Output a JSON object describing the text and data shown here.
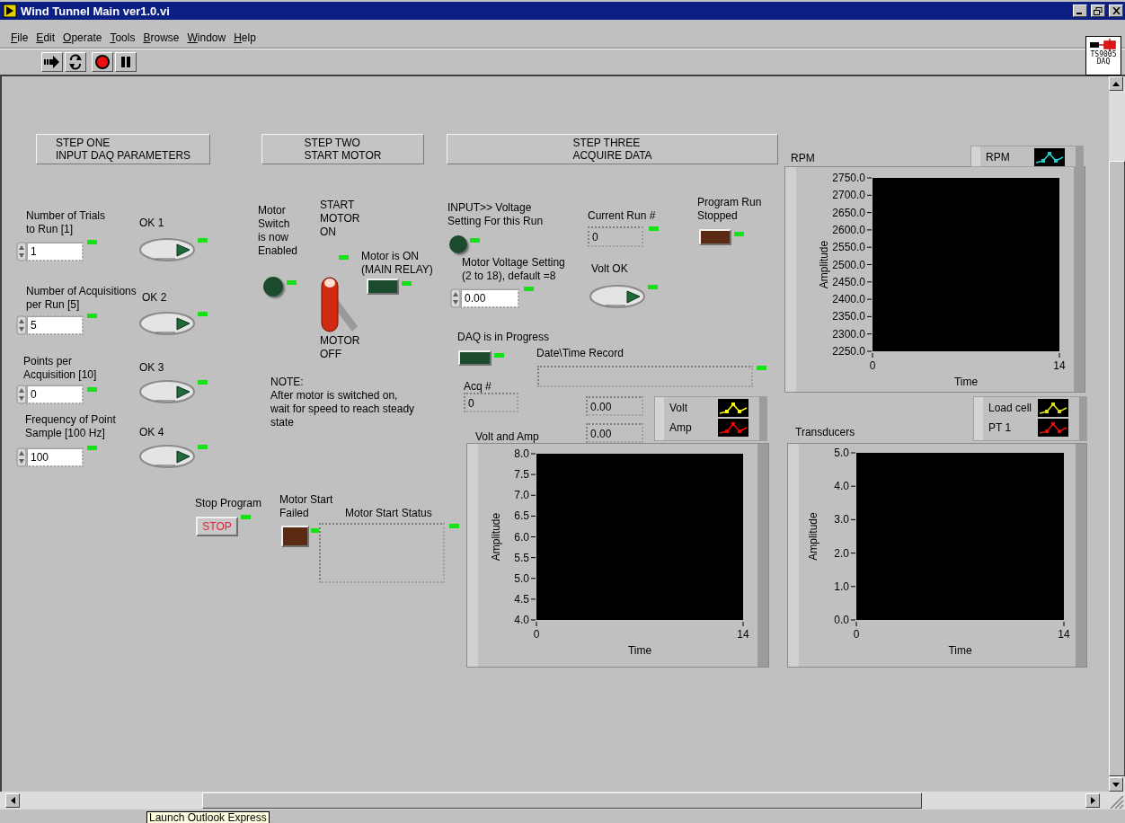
{
  "window": {
    "title": "Wind Tunnel Main ver1.0.vi"
  },
  "menu": [
    "File",
    "Edit",
    "Operate",
    "Tools",
    "Browse",
    "Window",
    "Help"
  ],
  "vi_icon": {
    "lines": [
      "TS9005",
      "DAQ"
    ]
  },
  "step_headers": [
    {
      "lines": [
        "STEP ONE",
        "INPUT DAQ PARAMETERS"
      ]
    },
    {
      "lines": [
        "STEP TWO",
        "START MOTOR"
      ]
    },
    {
      "lines": [
        "STEP THREE",
        "ACQUIRE DATA"
      ]
    }
  ],
  "numeric_controls": [
    {
      "label": [
        "Number of Trials",
        "to Run [1]"
      ],
      "value": "1"
    },
    {
      "label": [
        "Number of Acquisitions",
        "per Run [5]"
      ],
      "value": "5"
    },
    {
      "label": [
        "Points per",
        "Acquisition [10]"
      ],
      "value": "0"
    },
    {
      "label": [
        "Frequency of Point",
        "Sample [100 Hz]"
      ],
      "value": "100"
    },
    {
      "label": [
        "Motor Voltage Setting",
        "(2 to 18), default =8"
      ],
      "value": "0.00"
    }
  ],
  "ok_buttons": [
    {
      "label": "OK 1"
    },
    {
      "label": "OK 2"
    },
    {
      "label": "OK 3"
    },
    {
      "label": "OK 4"
    },
    {
      "label": "Volt OK"
    }
  ],
  "leds": [
    {
      "label": [
        "Motor",
        "Switch",
        "is now",
        "Enabled"
      ],
      "kind": "round",
      "on": false,
      "color": "#1c4a2c"
    },
    {
      "label": [
        "Motor is ON",
        "(MAIN RELAY)"
      ],
      "kind": "rect",
      "on": false,
      "color": "#1c4a2c"
    },
    {
      "label": [
        "INPUT>> Voltage",
        "Setting For this Run"
      ],
      "kind": "round",
      "on": false,
      "color": "#1c4a2c"
    },
    {
      "label": [
        "Program Run",
        "Stopped"
      ],
      "kind": "rect",
      "on": false,
      "color": "#5a2a12"
    },
    {
      "label": [
        "DAQ is in Progress"
      ],
      "kind": "rect",
      "on": false,
      "color": "#1c4a2c"
    },
    {
      "label": [
        "Motor Start",
        "Failed"
      ],
      "kind": "rect",
      "on": false,
      "color": "#5a2a12"
    }
  ],
  "toggle": {
    "top_label": [
      "START",
      "MOTOR",
      "ON"
    ],
    "bottom_label": [
      "MOTOR",
      "OFF"
    ],
    "on": false
  },
  "note": {
    "lines": [
      "NOTE:",
      "After motor is switched on,",
      "wait for speed to reach steady",
      "state"
    ]
  },
  "stop_button": {
    "label": "Stop Program",
    "text": "STOP"
  },
  "displays": [
    {
      "label": "Current Run #",
      "value": "0"
    },
    {
      "label": "Acq #",
      "value": "0"
    },
    {
      "label": "Date\\Time Record"
    },
    {
      "label": "Motor Start Status"
    },
    {
      "value": "0.00"
    },
    {
      "value": "0.00"
    }
  ],
  "graphs": [
    {
      "title": "RPM",
      "x_axis_title": "Time",
      "y_axis_title": "Amplitude",
      "x_axis_labels": [
        "0",
        "14"
      ],
      "y_axis_labels": [
        "2750.0",
        "2700.0",
        "2650.0",
        "2600.0",
        "2550.0",
        "2500.0",
        "2450.0",
        "2400.0",
        "2350.0",
        "2300.0",
        "2250.0"
      ],
      "legend": [
        {
          "name": "RPM",
          "color": "#20d0d0"
        }
      ]
    },
    {
      "title": "Volt and Amp",
      "x_axis_title": "Time",
      "y_axis_title": "Amplitude",
      "x_axis_labels": [
        "0",
        "14"
      ],
      "y_axis_labels": [
        "8.0",
        "7.5",
        "7.0",
        "6.5",
        "6.0",
        "5.5",
        "5.0",
        "4.5",
        "4.0"
      ],
      "legend": [
        {
          "name": "Volt",
          "color": "#ffff00"
        },
        {
          "name": "Amp",
          "color": "#ff0000"
        }
      ]
    },
    {
      "title": "Transducers",
      "x_axis_title": "Time",
      "y_axis_title": "Amplitude",
      "x_axis_labels": [
        "0",
        "14"
      ],
      "y_axis_labels": [
        "5.0",
        "4.0",
        "3.0",
        "2.0",
        "1.0",
        "0.0"
      ],
      "legend": [
        {
          "name": "Load cell",
          "color": "#e0e020"
        },
        {
          "name": "PT 1",
          "color": "#e01010"
        }
      ]
    }
  ],
  "tooltip": "Launch Outlook Express"
}
